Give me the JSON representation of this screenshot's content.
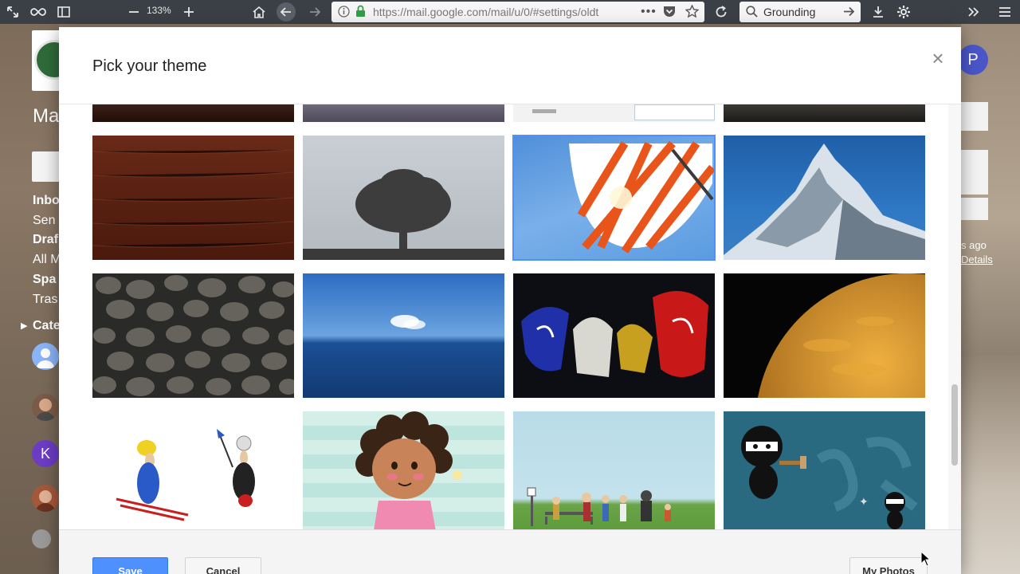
{
  "browser": {
    "zoom": "133%",
    "url": "https://mail.google.com/mail/u/0/#settings/oldt",
    "search_value": "Grounding"
  },
  "gmail_bg": {
    "app_partial": "Ma",
    "nav": [
      "Inbo",
      "Sen",
      "Draf",
      "All M",
      "Spa",
      "Tras"
    ],
    "categories_partial": "Cate",
    "avatar_k": "K",
    "account_initial": "P",
    "right_ago": "s ago",
    "right_details": "Details"
  },
  "modal": {
    "title": "Pick your theme",
    "close_symbol": "×",
    "save_label": "Save",
    "cancel_label": "Cancel",
    "my_photos_label": "My Photos"
  },
  "themes": [
    {
      "name": "Wood",
      "selected": false
    },
    {
      "name": "Tree",
      "selected": false
    },
    {
      "name": "Beach umbrella",
      "selected": true
    },
    {
      "name": "Mountain",
      "selected": false
    },
    {
      "name": "Pebbles",
      "selected": false
    },
    {
      "name": "Ocean",
      "selected": false
    },
    {
      "name": "Graffiti",
      "selected": false
    },
    {
      "name": "Planet",
      "selected": false
    },
    {
      "name": "Skiing cartoon",
      "selected": false
    },
    {
      "name": "Girl cartoon",
      "selected": false
    },
    {
      "name": "Park cartoon",
      "selected": false
    },
    {
      "name": "Ninja cartoon",
      "selected": false
    }
  ],
  "colors": {
    "accent": "#4d90fe",
    "toolbar": "#3b4046"
  }
}
